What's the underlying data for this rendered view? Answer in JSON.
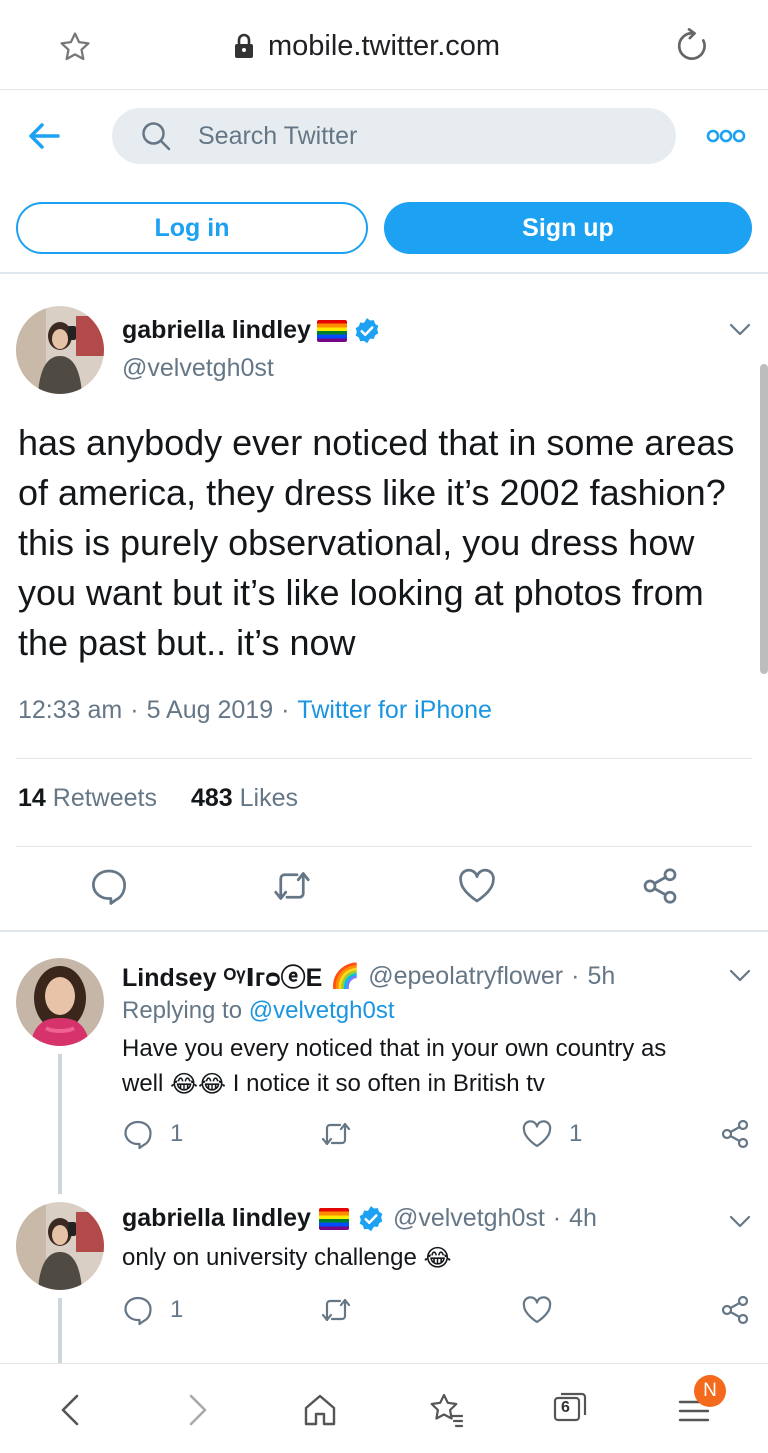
{
  "browser": {
    "url": "mobile.twitter.com"
  },
  "header": {
    "search_placeholder": "Search Twitter",
    "login_label": "Log in",
    "signup_label": "Sign up"
  },
  "tweet": {
    "author_name": "gabriella lindley",
    "author_handle": "@velvetgh0st",
    "text": "has anybody ever noticed that in some areas of america, they dress like it’s 2002 fashion? this is purely observational, you dress how you want but it’s like looking at photos from the past but.. it’s now",
    "time": "12:33 am",
    "date": "5 Aug 2019",
    "source": "Twitter for iPhone",
    "retweets_count": "14",
    "retweets_label": "Retweets",
    "likes_count": "483",
    "likes_label": "Likes"
  },
  "replies": [
    {
      "name": "Lindsey ᴼᵞⵏᴦᴑⓔE",
      "name_emoji": "🌈",
      "handle": "@epeolatryflower",
      "age": "5h",
      "replying_prefix": "Replying to",
      "replying_to": "@velvetgh0st",
      "line1": "Have you every noticed that in your own country as",
      "line2_start": "well",
      "line2_emoji": "😂😂",
      "line2_end": "I notice it so often in British tv",
      "reply_count": "1",
      "like_count": "1"
    },
    {
      "name": "gabriella lindley",
      "handle": "@velvetgh0st",
      "age": "4h",
      "text": "only on university challenge",
      "emoji": "😂",
      "reply_count": "1"
    }
  ],
  "bottom_bar": {
    "tab_count": "6",
    "badge": "N"
  },
  "colors": {
    "accent": "#1da1f2",
    "link": "#1b95e0",
    "muted": "#657786",
    "badge": "#f36a1d"
  }
}
